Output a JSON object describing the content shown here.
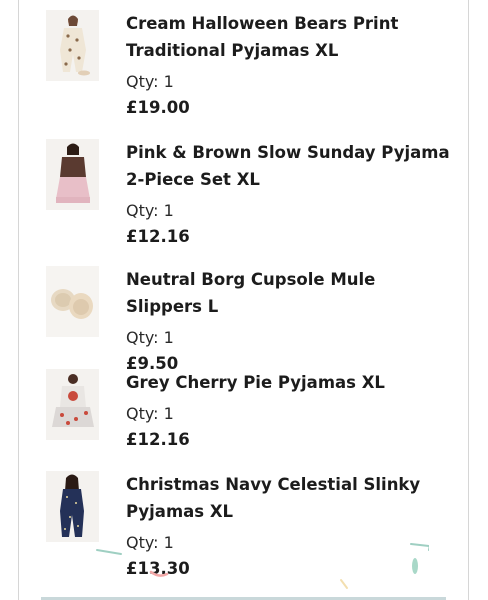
{
  "basket": {
    "items": [
      {
        "name": "Cream Halloween Bears Print Traditional Pyjamas XL",
        "qty_label": "Qty: 1",
        "price": "£19.00",
        "thumb_icon": "cream-bears-pyjamas-photo"
      },
      {
        "name": "Pink & Brown Slow Sunday Pyjama 2-Piece Set XL",
        "qty_label": "Qty: 1",
        "price": "£12.16",
        "thumb_icon": "pink-brown-pyjama-photo"
      },
      {
        "name": "Neutral Borg Cupsole Mule Slippers L",
        "qty_label": "Qty: 1",
        "price": "£9.50",
        "thumb_icon": "borg-slippers-photo"
      },
      {
        "name": "Grey Cherry Pie Pyjamas XL",
        "qty_label": "Qty: 1",
        "price": "£12.16",
        "thumb_icon": "grey-cherry-pie-pyjamas-photo"
      },
      {
        "name": "Christmas Navy Celestial Slinky Pyjamas XL",
        "qty_label": "Qty: 1",
        "price": "£13.30",
        "thumb_icon": "navy-celestial-pyjamas-photo"
      }
    ]
  },
  "colors": {
    "text": "#1c1c1c",
    "border": "#d6d6d6",
    "divider": "#c9d8da"
  }
}
